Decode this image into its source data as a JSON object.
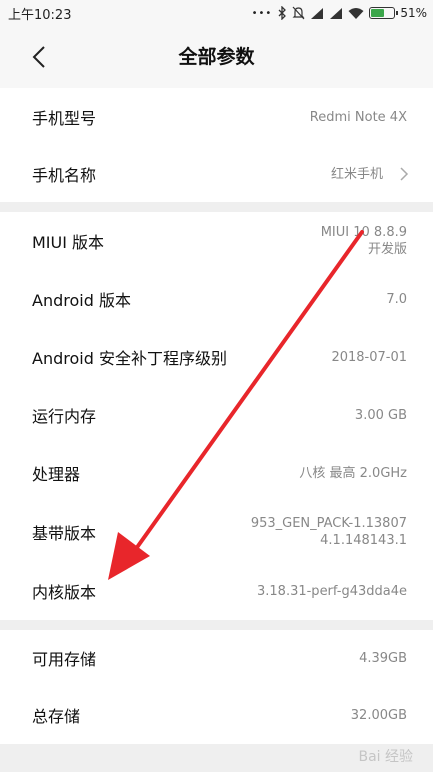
{
  "status_bar": {
    "time": "上午10:23",
    "dots": "•••",
    "battery_percent": "51%",
    "battery_level": 0.51,
    "icons": [
      "bluetooth-icon",
      "mute-icon",
      "signal-icon",
      "signal-icon",
      "wifi-icon",
      "battery-charging-icon"
    ]
  },
  "header": {
    "title": "全部参数",
    "back_icon": "chevron-left-icon"
  },
  "groups": [
    {
      "rows": [
        {
          "label": "手机型号",
          "value": "Redmi Note 4X"
        },
        {
          "label": "手机名称",
          "value": "红米手机",
          "chevron": true
        }
      ]
    },
    {
      "rows": [
        {
          "label": "MIUI 版本",
          "value_lines": [
            "MIUI 10 8.8.9",
            "开发版"
          ]
        },
        {
          "label": "Android 版本",
          "value": "7.0"
        },
        {
          "label": "Android 安全补丁程序级别",
          "value": "2018-07-01"
        },
        {
          "label": "运行内存",
          "value": "3.00 GB"
        },
        {
          "label": "处理器",
          "value": "八核 最高 2.0GHz"
        },
        {
          "label": "基带版本",
          "value_lines": [
            "953_GEN_PACK-1.13807",
            "4.1.148143.1"
          ]
        },
        {
          "label": "内核版本",
          "value": "3.18.31-perf-g43dda4e"
        }
      ]
    },
    {
      "rows": [
        {
          "label": "可用存储",
          "value": "4.39GB"
        },
        {
          "label": "总存储",
          "value": "32.00GB"
        }
      ]
    }
  ],
  "watermark": "Bai 经验",
  "annotation": {
    "color": "#e8262b"
  }
}
